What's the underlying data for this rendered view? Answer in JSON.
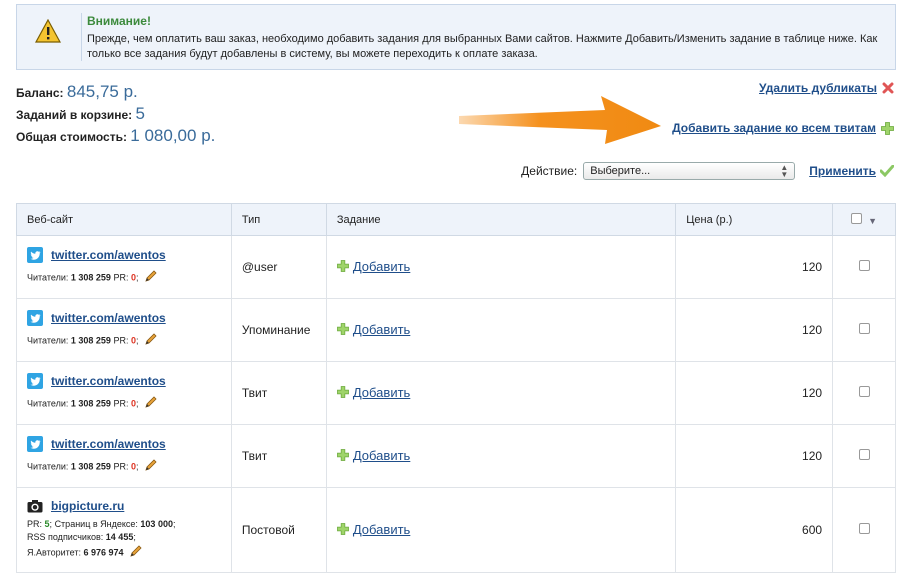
{
  "notice": {
    "title": "Внимание!",
    "text": "Прежде, чем оплатить ваш заказ, необходимо добавить задания для выбранных Вами сайтов. Нажмите Добавить/Изменить задание в таблице ниже. Как только все задания будут добавлены в систему, вы можете переходить к оплате заказа."
  },
  "stats": {
    "balance_label": "Баланс:",
    "balance_value": "845,75 р.",
    "tasks_label": "Заданий в корзине:",
    "tasks_value": "5",
    "total_label": "Общая стоимость:",
    "total_value": "1 080,00 р."
  },
  "actions": {
    "remove_duplicates": "Удалить дубликаты",
    "add_all": "Добавить задание ко всем твитам",
    "action_label": "Действие:",
    "select_value": "Выберите...",
    "apply": "Применить"
  },
  "table": {
    "headers": {
      "site": "Веб-сайт",
      "type": "Тип",
      "task": "Задание",
      "price": "Цена (р.)"
    },
    "add_label": "Добавить",
    "rows": [
      {
        "site": "twitter.com/awentos",
        "icon": "twitter-icon",
        "readers_label": "Читатели:",
        "readers": "1 308 259",
        "pr_label": "PR:",
        "pr": "0",
        "type": "@user",
        "price": "120"
      },
      {
        "site": "twitter.com/awentos",
        "icon": "twitter-icon",
        "readers_label": "Читатели:",
        "readers": "1 308 259",
        "pr_label": "PR:",
        "pr": "0",
        "type": "Упоминание",
        "price": "120"
      },
      {
        "site": "twitter.com/awentos",
        "icon": "twitter-icon",
        "readers_label": "Читатели:",
        "readers": "1 308 259",
        "pr_label": "PR:",
        "pr": "0",
        "type": "Твит",
        "price": "120"
      },
      {
        "site": "twitter.com/awentos",
        "icon": "twitter-icon",
        "readers_label": "Читатели:",
        "readers": "1 308 259",
        "pr_label": "PR:",
        "pr": "0",
        "type": "Твит",
        "price": "120"
      }
    ],
    "last_row": {
      "site": "bigpicture.ru",
      "icon": "camera-icon",
      "pr_label": "PR:",
      "pr": "5",
      "yandex_label": "Страниц в Яндексе:",
      "yandex": "103 000",
      "rss_label": "RSS подписчиков:",
      "rss": "14 455",
      "authority_label": "Я.Авторитет:",
      "authority": "6 976 974",
      "type": "Постовой",
      "price": "600"
    }
  },
  "colors": {
    "accent_link": "#1f4e8a",
    "notice_title": "#3c8a3c",
    "arrow": "#f5911e",
    "twitter": "#2fa4e3"
  }
}
